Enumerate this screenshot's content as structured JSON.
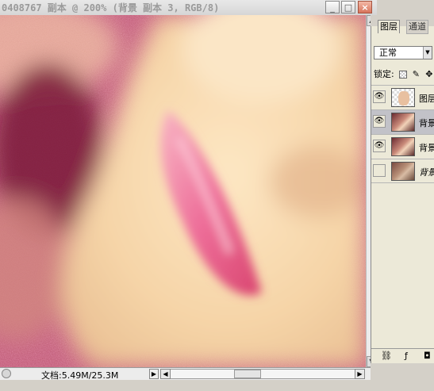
{
  "document": {
    "title": "0408767 副本 @ 200% (背景 副本 3, RGB/8)",
    "doc_size": "文档:5.49M/25.3M"
  },
  "window_buttons": {
    "minimize": "_",
    "maximize": "□",
    "close": "×"
  },
  "layers_panel": {
    "tabs": [
      {
        "label": "图层"
      },
      {
        "label": "通道"
      }
    ],
    "blend_mode": "正常",
    "lock_label": "锁定:",
    "layers": [
      {
        "name": "图层",
        "visible": true,
        "selected": false,
        "thumb": "transparent-girl"
      },
      {
        "name": "背景",
        "visible": true,
        "selected": true,
        "thumb": "portrait"
      },
      {
        "name": "背景",
        "visible": true,
        "selected": false,
        "thumb": "portrait"
      },
      {
        "name": "背景",
        "visible": false,
        "selected": false,
        "thumb": "portrait-dim"
      }
    ],
    "footer_icons": [
      "link-icon",
      "style-icon",
      "mask-icon"
    ]
  },
  "colors": {
    "panel_bg": "#ece9d8",
    "selected_row": "#c2c2c8",
    "title_text": "#9a9a9a"
  }
}
